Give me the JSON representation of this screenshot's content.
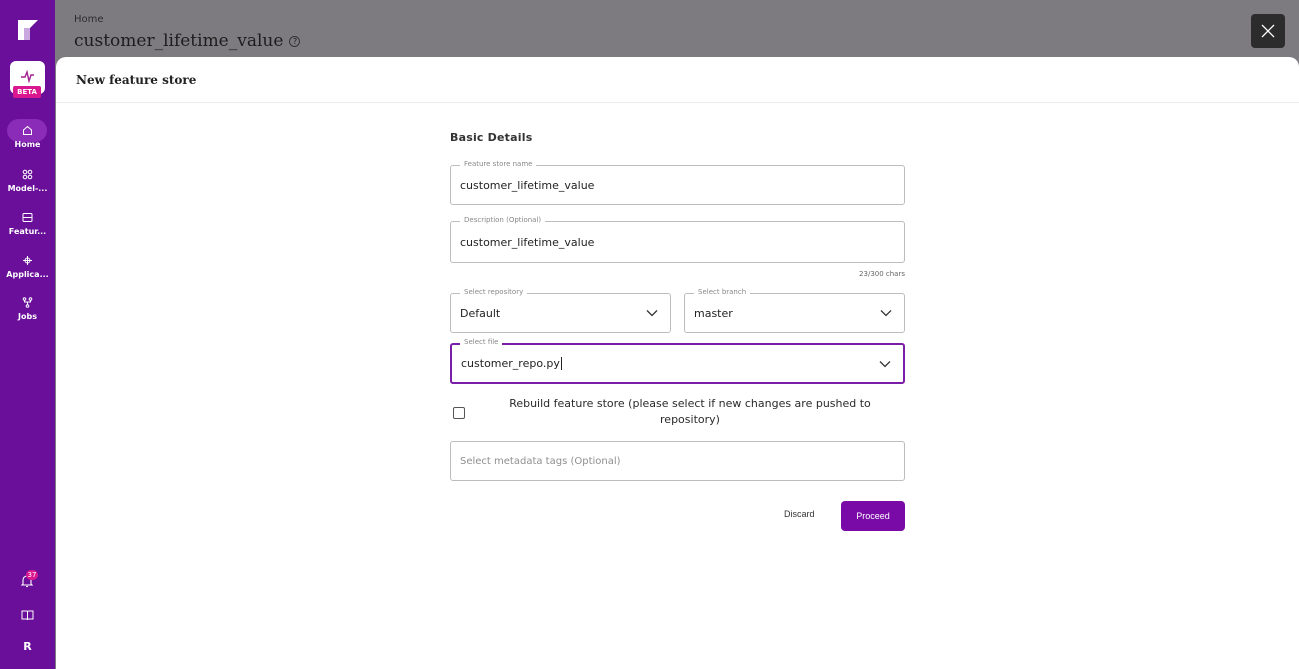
{
  "sidebar": {
    "beta_label": "BETA",
    "items": [
      {
        "label": "Home",
        "icon": "home-icon"
      },
      {
        "label": "Model-...",
        "icon": "model-icon"
      },
      {
        "label": "Featur...",
        "icon": "feature-icon"
      },
      {
        "label": "Applica...",
        "icon": "application-icon"
      },
      {
        "label": "Jobs",
        "icon": "jobs-icon"
      }
    ],
    "notification_count": "37",
    "avatar_initial": "R"
  },
  "background": {
    "breadcrumb": "Home",
    "page_title": "customer_lifetime_value",
    "help_glyph": "?"
  },
  "modal": {
    "title": "New feature store",
    "section_title": "Basic Details",
    "feature_store_name": {
      "legend": "Feature store name",
      "value": "customer_lifetime_value"
    },
    "description": {
      "legend": "Description (Optional)",
      "value": "customer_lifetime_value",
      "char_count": "23/300 chars"
    },
    "repository": {
      "legend": "Select repository",
      "value": "Default"
    },
    "branch": {
      "legend": "Select branch",
      "value": "master"
    },
    "file": {
      "legend": "Select file",
      "value": "customer_repo.py"
    },
    "rebuild_checkbox": {
      "label": "Rebuild feature store (please select if new changes are pushed to repository)",
      "checked": false
    },
    "metadata_tags": {
      "placeholder": "Select metadata tags (Optional)"
    },
    "discard_label": "Discard",
    "proceed_label": "Proceed"
  },
  "colors": {
    "sidebar": "#6a0f9a",
    "primary": "#7a0aa8",
    "beta_badge": "#d9178e"
  }
}
